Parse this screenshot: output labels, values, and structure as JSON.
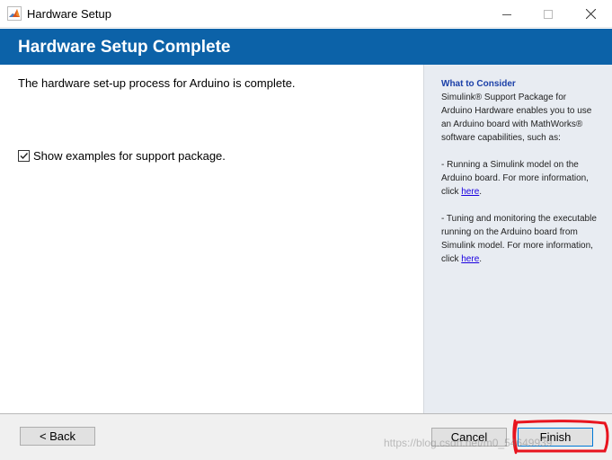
{
  "window": {
    "title": "Hardware Setup",
    "icon": "matlab-logo-icon"
  },
  "header": {
    "title": "Hardware Setup Complete",
    "background_color": "#0c62a8"
  },
  "content": {
    "message": "The hardware set-up process for Arduino is complete.",
    "checkbox_label": "Show examples for support package.",
    "checkbox_checked": true
  },
  "sidebar": {
    "heading": "What to Consider",
    "paragraph1": "Simulink® Support Package for Arduino Hardware enables you to use an Arduino board with MathWorks® software capabilities, such as:",
    "paragraph2_text": "- Running a Simulink model on the Arduino board. For more information, click ",
    "paragraph2_link": "here",
    "paragraph2_end": ".",
    "paragraph3_text": "- Tuning and monitoring the executable running on the Arduino board from Simulink model. For more information, click ",
    "paragraph3_link": "here",
    "paragraph3_end": "."
  },
  "footer": {
    "back_label": "< Back",
    "cancel_label": "Cancel",
    "finish_label": "Finish"
  },
  "watermark": "https://blog.csdn.net/m0_54649939",
  "colors": {
    "annotation": "#e8141e",
    "link": "#1a00e0",
    "sidebar_bg": "#e8ecf2"
  }
}
